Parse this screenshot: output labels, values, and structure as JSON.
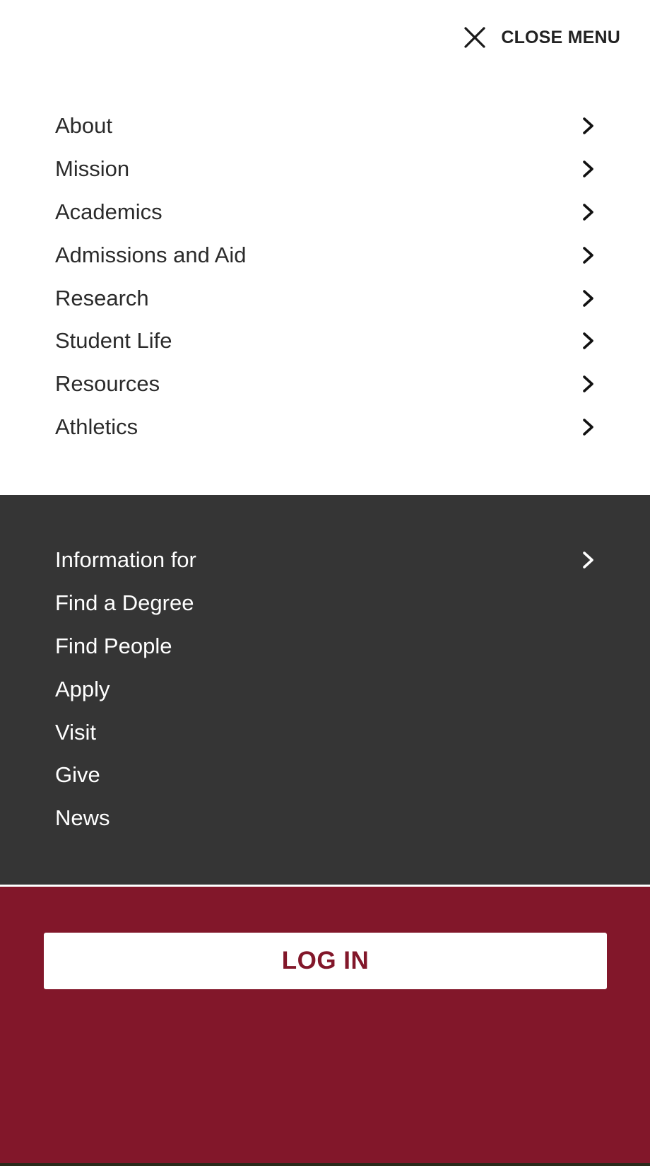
{
  "header": {
    "close_label": "CLOSE MENU",
    "close_icon": "close-x-icon"
  },
  "primary_nav": {
    "items": [
      {
        "label": "About",
        "icon": "chevron-right-icon"
      },
      {
        "label": "Mission",
        "icon": "chevron-right-icon"
      },
      {
        "label": "Academics",
        "icon": "chevron-right-icon"
      },
      {
        "label": "Admissions and Aid",
        "icon": "chevron-right-icon"
      },
      {
        "label": "Research",
        "icon": "chevron-right-icon"
      },
      {
        "label": "Student Life",
        "icon": "chevron-right-icon"
      },
      {
        "label": "Resources",
        "icon": "chevron-right-icon"
      },
      {
        "label": "Athletics",
        "icon": "chevron-right-icon"
      }
    ]
  },
  "secondary_nav": {
    "items": [
      {
        "label": "Information for",
        "icon": "chevron-right-icon"
      },
      {
        "label": "Find a Degree"
      },
      {
        "label": "Find People"
      },
      {
        "label": "Apply"
      },
      {
        "label": "Visit"
      },
      {
        "label": "Give"
      },
      {
        "label": "News"
      }
    ]
  },
  "login": {
    "label": "LOG IN"
  },
  "colors": {
    "maroon": "#82172a",
    "dark_gray": "#353535",
    "white": "#ffffff",
    "text_dark": "#2b2b2b"
  }
}
